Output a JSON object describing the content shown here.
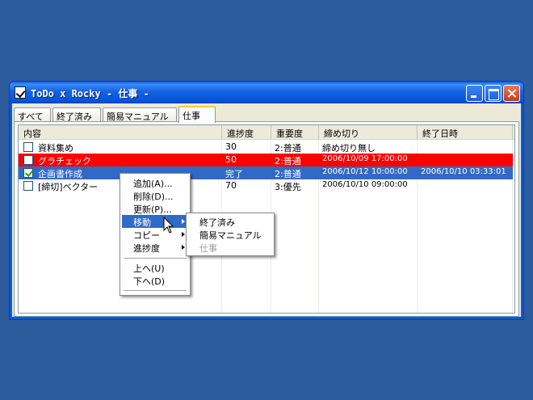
{
  "window": {
    "title": "ToDo x Rocky - 仕事 -"
  },
  "tabs": [
    {
      "label": "すべて",
      "active": false
    },
    {
      "label": "終了済み",
      "active": false
    },
    {
      "label": "簡易マニュアル",
      "active": false
    },
    {
      "label": "仕事",
      "active": true
    }
  ],
  "list": {
    "columns": [
      "内容",
      "進捗度",
      "重要度",
      "締め切り",
      "終了日時"
    ],
    "rows": [
      {
        "checked": false,
        "name": "資料集め",
        "progress": "30",
        "importance": "2:普通",
        "due": "締め切り無し",
        "done": "",
        "highlight": "none"
      },
      {
        "checked": false,
        "name": "グラチェック",
        "progress": "50",
        "importance": "2:普通",
        "due": "2006/10/09 17:00:00",
        "done": "",
        "highlight": "#ff0000"
      },
      {
        "checked": true,
        "name": "企画書作成",
        "progress": "完了",
        "importance": "2:普通",
        "due": "2006/10/12 10:00:00",
        "done": "2006/10/10 03:33:01",
        "highlight": "#316ac5"
      },
      {
        "checked": false,
        "name": "[締切]ベクター",
        "progress": "70",
        "importance": "3:優先",
        "due": "2006/10/10 09:00:00",
        "done": "",
        "highlight": "none"
      }
    ]
  },
  "context_menu": {
    "items": [
      {
        "label": "追加(A)..."
      },
      {
        "label": "削除(D)..."
      },
      {
        "label": "更新(P)..."
      },
      {
        "label": "移動",
        "submenu": true,
        "highlighted": true
      },
      {
        "label": "コピー",
        "submenu": true
      },
      {
        "label": "進捗度",
        "submenu": true
      },
      {
        "label": "上へ(U)"
      },
      {
        "label": "下へ(D)"
      }
    ]
  },
  "submenu": {
    "items": [
      {
        "label": "終了済み"
      },
      {
        "label": "簡易マニュアル"
      },
      {
        "label": "仕事",
        "disabled": true
      }
    ]
  },
  "colors": {
    "desktop": "#2c5c9c",
    "selection": "#316ac5",
    "overdue": "#ff0000"
  }
}
